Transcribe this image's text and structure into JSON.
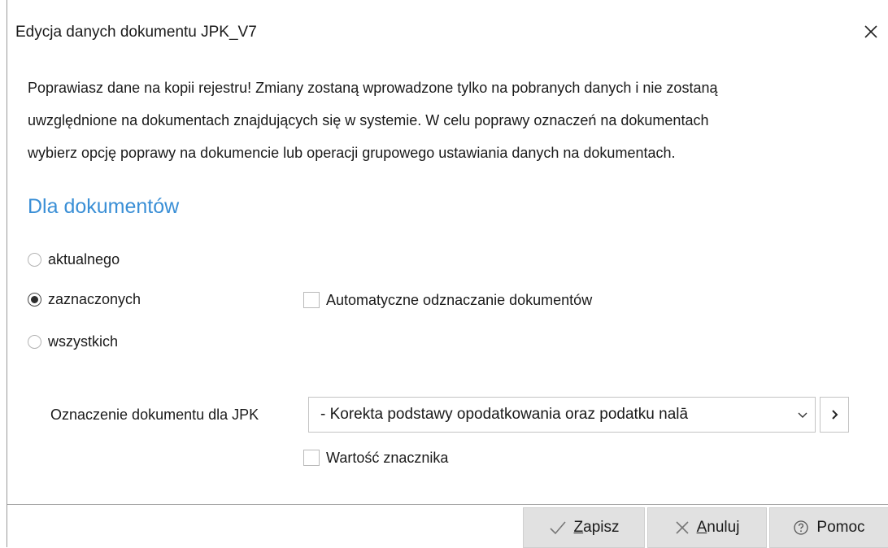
{
  "window": {
    "title": "Edycja danych dokumentu JPK_V7",
    "close_icon": "close-icon"
  },
  "info_lines": [
    "Poprawiasz dane na kopii rejestru! Zmiany zostaną wprowadzone tylko na pobranych danych i nie zostaną",
    "uwzględnione na dokumentach znajdujących się w systemie. W celu poprawy oznaczeń na dokumentach",
    "wybierz opcję poprawy na dokumencie lub operacji grupowego ustawiania danych na dokumentach."
  ],
  "section": {
    "title": "Dla dokumentów"
  },
  "scope_options": [
    {
      "label": "aktualnego",
      "checked": false
    },
    {
      "label": "zaznaczonych",
      "checked": true
    },
    {
      "label": "wszystkich",
      "checked": false
    }
  ],
  "auto_uncheck": {
    "label": "Automatyczne odznaczanie dokumentów",
    "checked": false
  },
  "jpk_field": {
    "label": "Oznaczenie dokumentu  dla JPK",
    "value": "- Korekta podstawy opodatkowania oraz podatku nalā",
    "arrow_icon": "chevron-down-icon",
    "next_icon": "chevron-right-icon"
  },
  "flag_value": {
    "label": "Wartość znacznika",
    "checked": false
  },
  "buttons": {
    "save": {
      "label_first": "Z",
      "label_rest": "apisz",
      "icon": "check-icon"
    },
    "cancel": {
      "label_first": "A",
      "label_rest": "nuluj",
      "icon": "close-icon"
    },
    "help": {
      "label": "Pomoc",
      "icon": "help-circle-icon"
    }
  },
  "colors": {
    "accent": "#3a8fd6",
    "button_bg": "#e1e1e1"
  }
}
